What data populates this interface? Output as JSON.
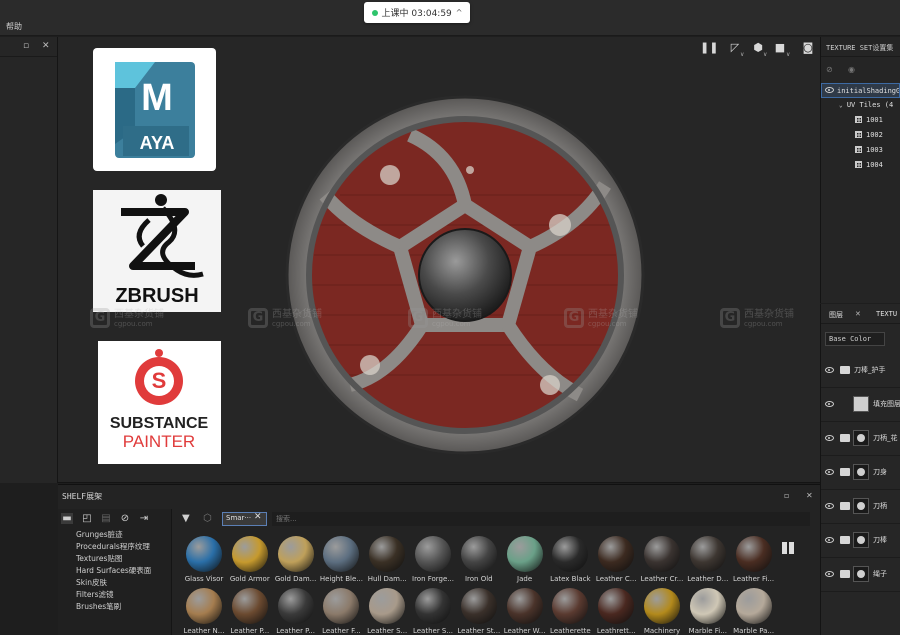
{
  "menubar": {
    "help": "帮助"
  },
  "live": {
    "status": "上课中 03:04:59"
  },
  "left_panel": {
    "restore_icon": "restore-icon",
    "close_icon": "close-icon"
  },
  "viewport": {
    "toolbar_icons": [
      "pause-icon",
      "camera-view-icon",
      "cube-icon",
      "video-camera-icon",
      "screenshot-icon"
    ],
    "maya_logo": {
      "letter": "M",
      "word": "AYA"
    },
    "zbrush_logo": {
      "word": "ZBRUSH"
    },
    "painter_logo": {
      "line1": "SUBSTANCE",
      "line2": "PAINTER"
    },
    "watermark": {
      "name": "西基杂货铺",
      "url": "cgpou.com"
    }
  },
  "texture_set": {
    "title": "TEXTURE SET设置集",
    "root": "initialShadingGroup",
    "uv_tiles": "UV Tiles (4",
    "tiles": [
      "1001",
      "1002",
      "1003",
      "1004"
    ]
  },
  "layers": {
    "tab_layers": "图层",
    "tab_texture": "TEXTU",
    "channel": "Base Color",
    "items": [
      {
        "name": "刀棒_护手",
        "type": "folder"
      },
      {
        "name": "填充图层",
        "type": "fill"
      },
      {
        "name": "刀柄_花",
        "type": "folder"
      },
      {
        "name": "刀身",
        "type": "folder"
      },
      {
        "name": "刀柄",
        "type": "folder"
      },
      {
        "name": "刀棒",
        "type": "folder"
      },
      {
        "name": "绳子",
        "type": "folder"
      }
    ]
  },
  "shelf": {
    "title": "SHELF展架",
    "categories": [
      "Grunges脏迹",
      "Procedurals程序纹理",
      "Textures贴图",
      "Hard Surfaces硬表面",
      "Skin皮肤",
      "Filters滤镜",
      "Brushes笔刷"
    ],
    "search_chip": "Smar···",
    "search_placeholder": "搜索...",
    "materials_row1": [
      "Glass Visor",
      "Gold Armor",
      "Gold Dam...",
      "Height Ble...",
      "Hull Dam...",
      "Iron Forge...",
      "Iron Old",
      "Jade",
      "Latex Black",
      "Leather C...",
      "Leather Cr...",
      "Leather D...",
      "Leather Fi..."
    ],
    "materials_row2": [
      "Leather N...",
      "Leather P...",
      "Leather P...",
      "Leather F...",
      "Leather S...",
      "Leather S...",
      "Leather St...",
      "Leather W...",
      "Leatherette",
      "Leathrett...",
      "Machinery",
      "Marble Fi...",
      "Marble Pa..."
    ]
  }
}
